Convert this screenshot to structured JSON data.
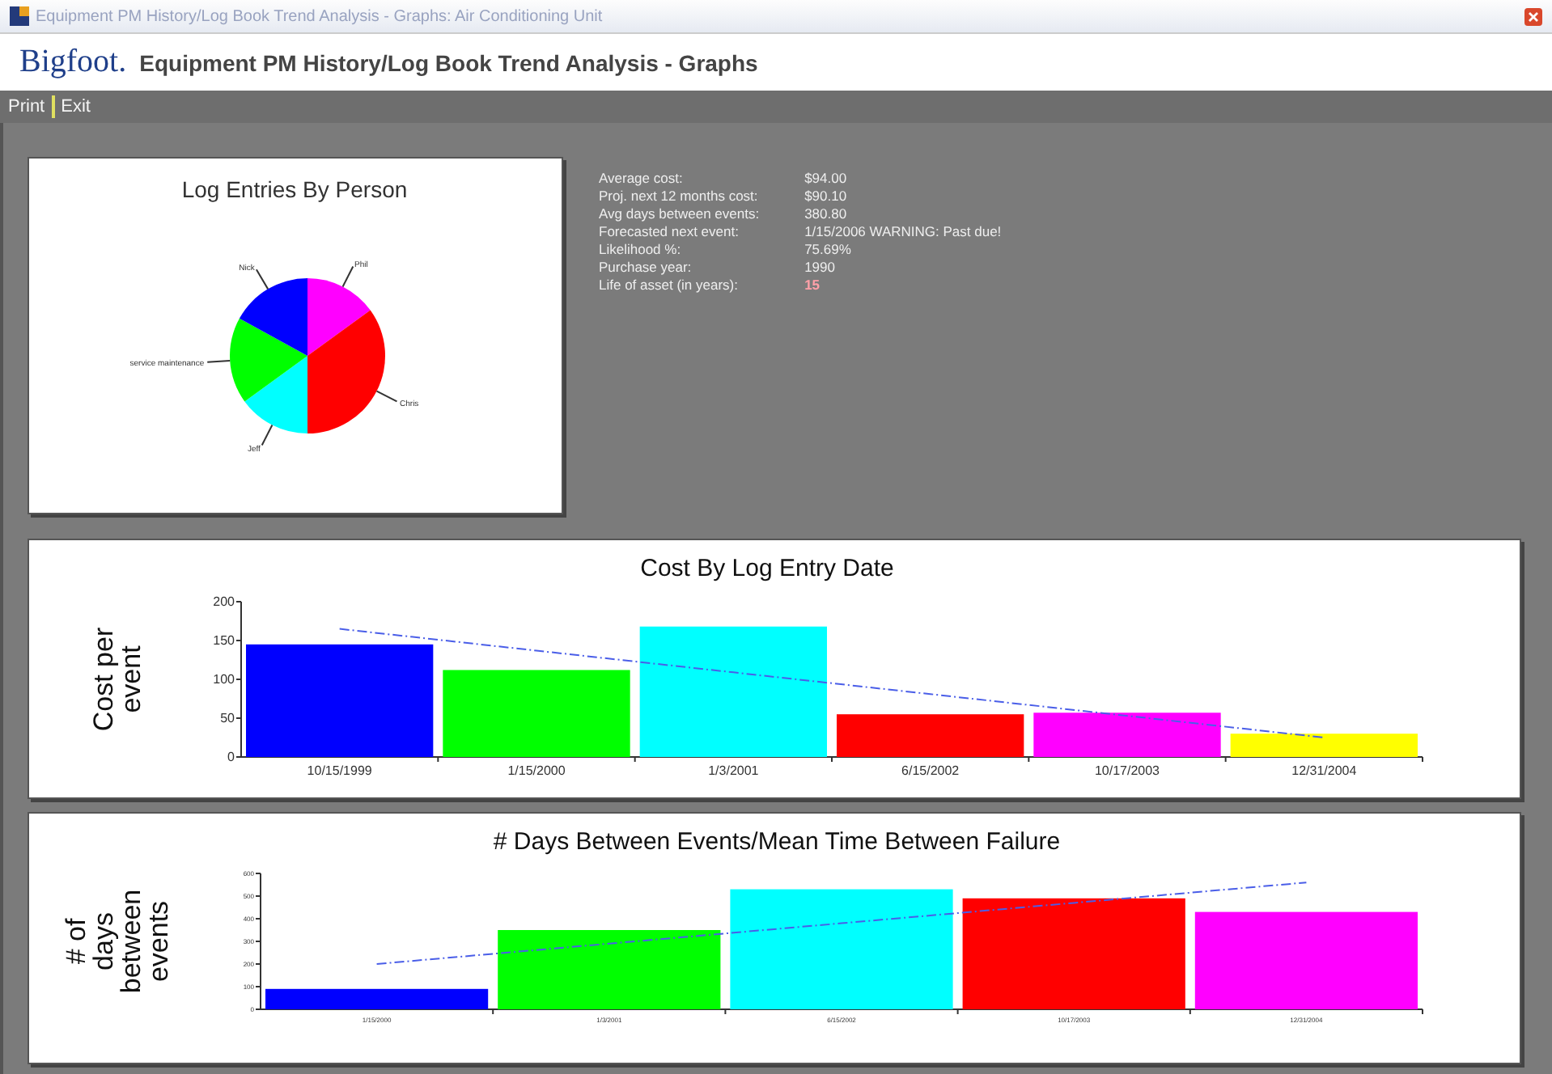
{
  "window": {
    "title": "Equipment PM History/Log Book Trend Analysis - Graphs: Air Conditioning Unit"
  },
  "header": {
    "logo": "Bigfoot.",
    "title": "Equipment PM History/Log Book Trend Analysis - Graphs"
  },
  "toolbar": [
    "Print",
    "Exit"
  ],
  "pie_panel": {
    "chart_data": {
      "type": "pie",
      "title": "Log Entries By Person",
      "categories": [
        "Phil",
        "Chris",
        "Jeff",
        "service maintenance",
        "Nick"
      ],
      "series": [
        {
          "values": [
            15,
            35,
            15,
            18,
            17
          ]
        }
      ],
      "colors": [
        "#ff00ff",
        "#ff0000",
        "#00ffff",
        "#00ff00",
        "#0000ff"
      ]
    }
  },
  "stats": [
    {
      "label": "Average cost:",
      "value": "$94.00",
      "alert": false
    },
    {
      "label": "Proj. next 12 months cost:",
      "value": "$90.10",
      "alert": false
    },
    {
      "label": "Avg days between events:",
      "value": "380.80",
      "alert": false
    },
    {
      "label": "Forecasted next event:",
      "value": "1/15/2006 WARNING: Past due!",
      "alert": false
    },
    {
      "label": "Likelihood %:",
      "value": "75.69%",
      "alert": false
    },
    {
      "label": "Purchase year:",
      "value": "1990",
      "alert": false
    },
    {
      "label": "Life of asset (in years):",
      "value": "15",
      "alert": true
    }
  ],
  "cost_panel": {
    "chart_data": {
      "type": "bar",
      "title": "Cost By Log Entry Date",
      "ylabel": "Cost per event",
      "categories": [
        "10/15/1999",
        "1/15/2000",
        "1/3/2001",
        "6/15/2002",
        "10/17/2003",
        "12/31/2004"
      ],
      "ylim": [
        0,
        200
      ],
      "yticks": [
        0,
        50,
        100,
        150,
        200
      ],
      "series": [
        {
          "values": [
            145,
            112,
            168,
            55,
            57,
            30
          ],
          "colors": [
            "#0000ff",
            "#00ff00",
            "#00ffff",
            "#ff0000",
            "#ff00ff",
            "#ffff00"
          ]
        },
        {
          "type": "line",
          "line_style": "dashdot",
          "color": "#4a5ee8",
          "values": [
            165,
            137,
            109,
            81,
            53,
            25
          ]
        }
      ]
    }
  },
  "days_panel": {
    "chart_data": {
      "type": "bar",
      "title": "# Days Between Events/Mean Time Between Failure",
      "ylabel": "# of days between events",
      "categories": [
        "1/15/2000",
        "1/3/2001",
        "6/15/2002",
        "10/17/2003",
        "12/31/2004"
      ],
      "ylim": [
        0,
        600
      ],
      "yticks": [
        0,
        100,
        200,
        300,
        400,
        500,
        600
      ],
      "series": [
        {
          "values": [
            90,
            350,
            530,
            490,
            430
          ],
          "colors": [
            "#0000ff",
            "#00ff00",
            "#00ffff",
            "#ff0000",
            "#ff00ff"
          ]
        },
        {
          "type": "line",
          "line_style": "dashdot",
          "color": "#4a5ee8",
          "values": [
            200,
            290,
            380,
            470,
            560
          ]
        }
      ]
    }
  }
}
